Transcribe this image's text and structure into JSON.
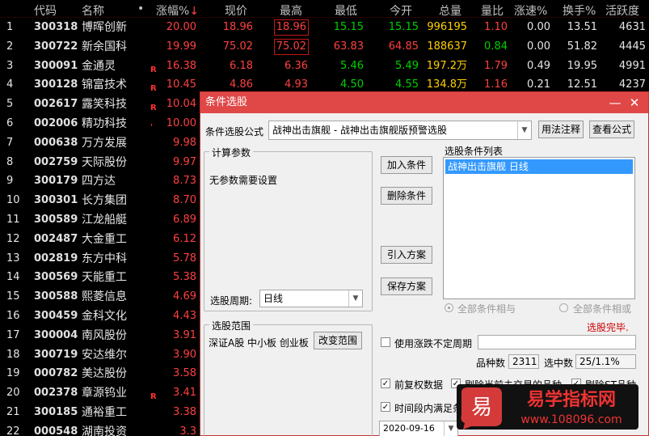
{
  "table": {
    "headers": [
      "代码",
      "名称",
      "•",
      "涨幅%",
      "现价",
      "最高",
      "最低",
      "今开",
      "总量",
      "量比",
      "涨速%",
      "换手%",
      "活跃度"
    ],
    "sort_arrow": "↓",
    "rows": [
      {
        "no": "1",
        "code": "300318",
        "name": "博晖创新",
        "mark": "",
        "chg": "20.00",
        "price": "18.96",
        "high": "18.96",
        "low": "15.15",
        "open": "15.15",
        "vol": "996195",
        "vr": "1.10",
        "spd": "0.00",
        "turn": "13.51",
        "act": "4631"
      },
      {
        "no": "2",
        "code": "300722",
        "name": "新余国科",
        "mark": "",
        "chg": "19.99",
        "price": "75.02",
        "high": "75.02",
        "low": "63.83",
        "open": "64.85",
        "vol": "188637",
        "vr": "0.84",
        "spd": "0.00",
        "turn": "51.82",
        "act": "4445"
      },
      {
        "no": "3",
        "code": "300091",
        "name": "金通灵",
        "mark": "R",
        "chg": "16.38",
        "price": "6.18",
        "high": "6.36",
        "low": "5.46",
        "open": "5.49",
        "vol": "197.2万",
        "vr": "1.79",
        "spd": "0.49",
        "turn": "19.95",
        "act": "4991"
      },
      {
        "no": "4",
        "code": "300128",
        "name": "锦富技术",
        "mark": "R",
        "chg": "10.45",
        "price": "4.86",
        "high": "4.93",
        "low": "4.50",
        "open": "4.55",
        "vol": "134.8万",
        "vr": "1.16",
        "spd": "0.21",
        "turn": "12.51",
        "act": "4237"
      },
      {
        "no": "5",
        "code": "002617",
        "name": "露笑科技",
        "mark": "R",
        "chg": "10.04"
      },
      {
        "no": "6",
        "code": "002006",
        "name": "精功科技",
        "mark": "'",
        "chg": "10.00"
      },
      {
        "no": "7",
        "code": "000638",
        "name": "万方发展",
        "mark": "",
        "chg": "9.98"
      },
      {
        "no": "8",
        "code": "002759",
        "name": "天际股份",
        "mark": "",
        "chg": "9.97"
      },
      {
        "no": "9",
        "code": "300179",
        "name": "四方达",
        "mark": "",
        "chg": "8.73"
      },
      {
        "no": "10",
        "code": "300301",
        "name": "长方集团",
        "mark": "",
        "chg": "8.70"
      },
      {
        "no": "11",
        "code": "300589",
        "name": "江龙船艇",
        "mark": "",
        "chg": "6.89"
      },
      {
        "no": "12",
        "code": "002487",
        "name": "大金重工",
        "mark": "",
        "chg": "6.12"
      },
      {
        "no": "13",
        "code": "002819",
        "name": "东方中科",
        "mark": "",
        "chg": "5.78"
      },
      {
        "no": "14",
        "code": "300569",
        "name": "天能重工",
        "mark": "",
        "chg": "5.38"
      },
      {
        "no": "15",
        "code": "300588",
        "name": "熙菱信息",
        "mark": "",
        "chg": "4.69"
      },
      {
        "no": "16",
        "code": "300459",
        "name": "金科文化",
        "mark": "",
        "chg": "4.43"
      },
      {
        "no": "17",
        "code": "300004",
        "name": "南风股份",
        "mark": "",
        "chg": "3.91"
      },
      {
        "no": "18",
        "code": "300719",
        "name": "安达维尔",
        "mark": "",
        "chg": "3.90"
      },
      {
        "no": "19",
        "code": "000782",
        "name": "美达股份",
        "mark": "",
        "chg": "3.58"
      },
      {
        "no": "20",
        "code": "002378",
        "name": "章源钨业",
        "mark": "R",
        "chg": "3.41"
      },
      {
        "no": "21",
        "code": "300185",
        "name": "通裕重工",
        "mark": "",
        "chg": "3.38"
      },
      {
        "no": "22",
        "code": "000548",
        "name": "湖南投资",
        "mark": "",
        "chg": "3.3"
      }
    ]
  },
  "dialog": {
    "title": "条件选股",
    "minimize": "—",
    "close": "✕",
    "formula_label": "条件选股公式",
    "formula_value": "战神出击旗舰 - 战神出击旗舰版预警选股",
    "usage_btn": "用法注释",
    "view_btn": "查看公式",
    "params_title": "计算参数",
    "params_text": "无参数需要设置",
    "period_label": "选股周期:",
    "period_value": "日线",
    "add_btn": "加入条件",
    "del_btn": "删除条件",
    "import_btn": "引入方案",
    "save_btn": "保存方案",
    "list_title": "选股条件列表",
    "list_items": [
      "战神出击旗舰  日线"
    ],
    "radio_and": "全部条件相与",
    "radio_or": "全部条件相或",
    "status": "选股完毕.",
    "range_title": "选股范围",
    "range_text": "深证A股 中小板 创业板",
    "change_range_btn": "改变范围",
    "use_period_label": "使用涨跌不定周期",
    "count_label": "品种数",
    "count_value": "2311",
    "selected_label": "选中数",
    "selected_value": "25/1.1%",
    "fq_label": "前复权数据",
    "excl_label": "剔除当前未交易的品种",
    "st_label": "剔除ST品种",
    "time_label": "时间段内满足条件",
    "date_value": "2020-09-16",
    "colors": {
      "title_bar": "#e04848",
      "selected": "#3399ff",
      "status": "#cc0000"
    }
  },
  "watermark": {
    "char": "易",
    "text": "易学指标网",
    "url": "www.108096.com"
  }
}
